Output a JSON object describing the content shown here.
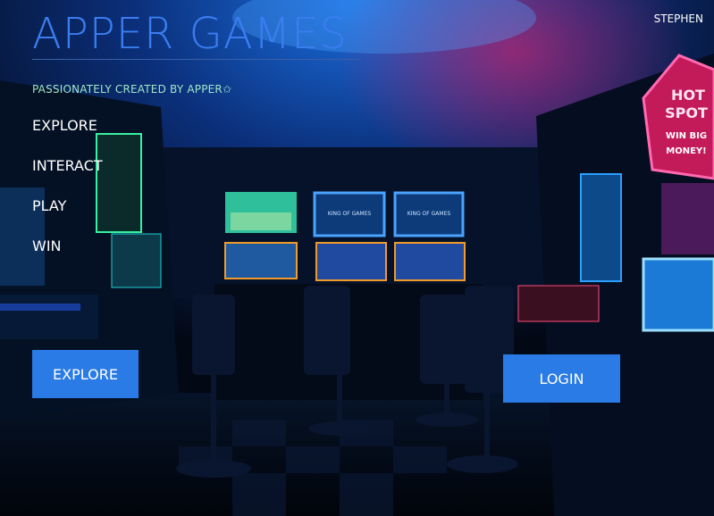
{
  "app": {
    "title": "APPER GAMES",
    "tagline": "PASSIONATELY CREATED BY APPER✩",
    "user": "STEPHEN"
  },
  "nav": {
    "items": [
      "EXPLORE",
      "INTERACT",
      "PLAY",
      "WIN"
    ]
  },
  "buttons": {
    "explore": "EXPLORE",
    "login": "LOGIN"
  },
  "background": {
    "screens": [
      "KING OF GAMES",
      "KING OF GAMES"
    ],
    "sign": [
      "HOT",
      "SPOT",
      "WIN BIG",
      "MONEY!"
    ]
  },
  "colors": {
    "accent": "#2a7be6",
    "title": "#3b7df0",
    "tagline": "#9fe6c7"
  }
}
